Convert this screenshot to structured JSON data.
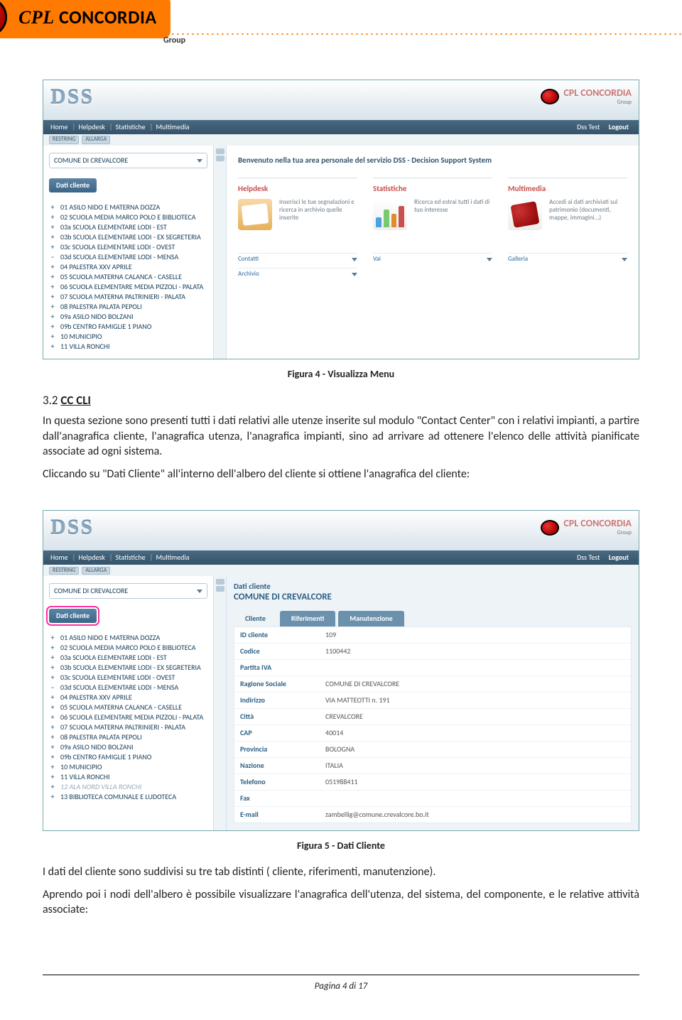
{
  "logo": {
    "brand": "CPL CONCORDIA",
    "sub": "Group"
  },
  "captions": {
    "fig4": "Figura 4 - Visualizza Menu",
    "fig5": "Figura 5 - Dati Cliente"
  },
  "section": {
    "number": "3.2",
    "title": "CC CLI"
  },
  "paragraphs": {
    "p1": "In questa sezione sono presenti tutti i dati relativi alle utenze inserite sul modulo \"Contact Center\" con i relativi impianti, a partire dall'anagrafica cliente, l'anagrafica utenza, l'anagrafica impianti, sino ad arrivare ad ottenere l'elenco delle attività pianificate associate ad ogni sistema.",
    "p2": "Cliccando su \"Dati Cliente\" all'interno dell'albero del cliente si ottiene l'anagrafica del cliente:",
    "p3": "I dati del cliente sono suddivisi su tre tab distinti ( cliente, riferimenti, manutenzione).",
    "p4": "Aprendo poi i nodi dell'albero è possibile visualizzare l'anagrafica dell'utenza, del sistema, del componente, e le relative attività associate:"
  },
  "footer": {
    "text": "Pagina 4 di 17"
  },
  "shot_common": {
    "nav": {
      "home": "Home",
      "helpdesk": "Helpdesk",
      "stats": "Statistiche",
      "multi": "Multimedia",
      "user": "Dss Test",
      "logout": "Logout"
    },
    "ribbon": {
      "r1": "RESTRING",
      "r2": "ALLARGA"
    },
    "combo": "COMUNE DI CREVALCORE",
    "dati_btn": "Dati cliente",
    "brand": "CPL CONCORDIA",
    "brand_sub": "Group"
  },
  "shot1": {
    "welcome": "Benvenuto nella tua area personale del servizio DSS - Decision Support System",
    "cards": {
      "helpdesk": {
        "title": "Helpdesk",
        "text": "Inserisci le tue segnalazioni e ricerca in archivio quelle inserite",
        "link1": "Contatti",
        "link2": "Archivio"
      },
      "stats": {
        "title": "Statistiche",
        "text": "Ricerca ed estrai tutti i dati di tuo interesse",
        "link1": "Vai"
      },
      "multi": {
        "title": "Multimedia",
        "text": "Accedi ai dati archiviati sul patrimonio (documenti, mappe, immagini...)",
        "link1": "Galleria"
      }
    },
    "tree": [
      {
        "pm": "plus",
        "label": "01 ASILO NIDO E MATERNA DOZZA"
      },
      {
        "pm": "plus",
        "label": "02 SCUOLA MEDIA MARCO POLO E BIBLIOTECA"
      },
      {
        "pm": "plus",
        "label": "03a SCUOLA ELEMENTARE LODI - EST"
      },
      {
        "pm": "plus",
        "label": "03b SCUOLA ELEMENTARE LODI - EX SEGRETERIA"
      },
      {
        "pm": "plus",
        "label": "03c SCUOLA ELEMENTARE LODI - OVEST"
      },
      {
        "pm": "minus",
        "label": "03d SCUOLA ELEMENTARE LODI - MENSA"
      },
      {
        "pm": "plus",
        "label": "04 PALESTRA XXV APRILE"
      },
      {
        "pm": "plus",
        "label": "05 SCUOLA MATERNA CALANCA - CASELLE"
      },
      {
        "pm": "plus",
        "label": "06 SCUOLA ELEMENTARE MEDIA PIZZOLI - PALATA"
      },
      {
        "pm": "plus",
        "label": "07 SCUOLA MATERNA PALTRINIERI - PALATA"
      },
      {
        "pm": "plus",
        "label": "08 PALESTRA PALATA PEPOLI"
      },
      {
        "pm": "plus",
        "label": "09a ASILO NIDO BOLZANI"
      },
      {
        "pm": "plus",
        "label": "09b CENTRO FAMIGLIE 1 PIANO"
      },
      {
        "pm": "plus",
        "label": "10 MUNICIPIO"
      },
      {
        "pm": "plus",
        "label": "11 VILLA RONCHI"
      }
    ]
  },
  "shot2": {
    "hdr1": "Dati cliente",
    "hdr2": "COMUNE DI CREVALCORE",
    "tabs": {
      "t1": "Cliente",
      "t2": "Riferimenti",
      "t3": "Manutenzione"
    },
    "rows": [
      {
        "k": "ID cliente",
        "v": "109"
      },
      {
        "k": "Codice",
        "v": "1100442"
      },
      {
        "k": "Partita IVA",
        "v": ""
      },
      {
        "k": "Ragione Sociale",
        "v": "COMUNE DI CREVALCORE"
      },
      {
        "k": "Indirizzo",
        "v": "VIA MATTEOTTI n. 191"
      },
      {
        "k": "Città",
        "v": "CREVALCORE"
      },
      {
        "k": "CAP",
        "v": "40014"
      },
      {
        "k": "Provincia",
        "v": "BOLOGNA"
      },
      {
        "k": "Nazione",
        "v": "ITALIA"
      },
      {
        "k": "Telefono",
        "v": "051988411"
      },
      {
        "k": "Fax",
        "v": ""
      },
      {
        "k": "E-mail",
        "v": "zambellig@comune.crevalcore.bo.it"
      }
    ],
    "tree": [
      {
        "pm": "plus",
        "label": "01 ASILO NIDO E MATERNA DOZZA"
      },
      {
        "pm": "plus",
        "label": "02 SCUOLA MEDIA MARCO POLO E BIBLIOTECA"
      },
      {
        "pm": "plus",
        "label": "03a SCUOLA ELEMENTARE LODI - EST"
      },
      {
        "pm": "plus",
        "label": "03b SCUOLA ELEMENTARE LODI - EX SEGRETERIA"
      },
      {
        "pm": "plus",
        "label": "03c SCUOLA ELEMENTARE LODI - OVEST"
      },
      {
        "pm": "minus",
        "label": "03d SCUOLA ELEMENTARE LODI - MENSA"
      },
      {
        "pm": "plus",
        "label": "04 PALESTRA XXV APRILE"
      },
      {
        "pm": "plus",
        "label": "05 SCUOLA MATERNA CALANCA - CASELLE"
      },
      {
        "pm": "plus",
        "label": "06 SCUOLA ELEMENTARE MEDIA PIZZOLI - PALATA"
      },
      {
        "pm": "plus",
        "label": "07 SCUOLA MATERNA PALTRINIERI - PALATA"
      },
      {
        "pm": "plus",
        "label": "08 PALESTRA PALATA PEPOLI"
      },
      {
        "pm": "plus",
        "label": "09a ASILO NIDO BOLZANI"
      },
      {
        "pm": "plus",
        "label": "09b CENTRO FAMIGLIE 1 PIANO"
      },
      {
        "pm": "plus",
        "label": "10 MUNICIPIO"
      },
      {
        "pm": "plus",
        "label": "11 VILLA RONCHI"
      },
      {
        "pm": "plus",
        "label": "12 ALA NORD VILLA RONCHI",
        "gray": true
      },
      {
        "pm": "plus",
        "label": "13 BIBLIOTECA COMUNALE E LUDOTECA"
      }
    ]
  }
}
